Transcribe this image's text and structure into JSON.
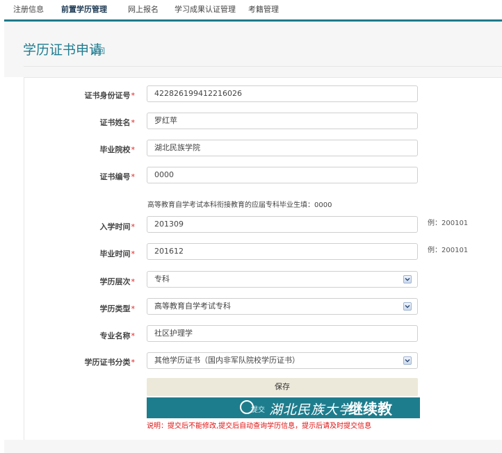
{
  "nav": {
    "items": [
      "注册信息",
      "前置学历管理",
      "网上报名",
      "学习成果认证管理",
      "考籍管理"
    ],
    "active_index": 1
  },
  "header": {
    "title": "学历证书申请",
    "back_label": "返回"
  },
  "form": {
    "required_mark": "*",
    "fields": [
      {
        "label": "证书身份证号",
        "value": "422826199412216026"
      },
      {
        "label": "证书姓名",
        "value": "罗红苹"
      },
      {
        "label": "毕业院校",
        "value": "湖北民族学院"
      },
      {
        "label": "证书编号",
        "value": "0000"
      },
      {
        "label": "入学时间",
        "value": "201309"
      },
      {
        "label": "毕业时间",
        "value": "201612"
      },
      {
        "label": "学历层次",
        "value": "专科"
      },
      {
        "label": "学历类型",
        "value": "高等教育自学考试专科"
      },
      {
        "label": "专业名称",
        "value": "社区护理学"
      },
      {
        "label": "学历证书分类",
        "value": "其他学历证书（国内非军队院校学历证书）"
      }
    ],
    "cert_number_note": "高等教育自学考试本科衔接教育的应届专科毕业生填：0000",
    "date_hint": "例：200101",
    "save_label": "保存",
    "warning": "说明：提交后不能修改,提交后自动查询学历信息，提示后请及时提交信息"
  },
  "banner": {
    "hidden_button_label": "提交",
    "brand_text": "湖北民族大学",
    "brand_text_bold": "继续教"
  },
  "colors": {
    "accent": "#1e7d92",
    "banner": "#1e7d8d",
    "required": "#e02020",
    "save_bg": "#ede9da"
  }
}
